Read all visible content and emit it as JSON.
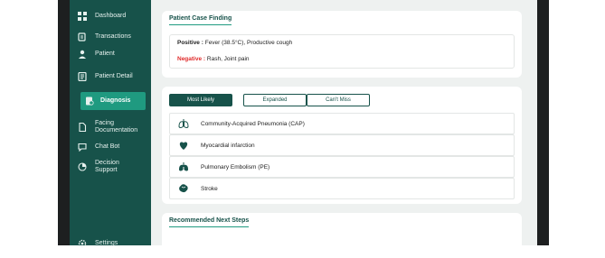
{
  "sidebar": {
    "items": [
      {
        "label": "Dashboard",
        "icon": "dashboard-icon"
      },
      {
        "label": "Transactions",
        "icon": "transactions-icon"
      },
      {
        "label": "Patient",
        "icon": "patient-icon"
      },
      {
        "label": "Patient Detail",
        "icon": "patient-detail-icon"
      },
      {
        "label": "Diagnosis",
        "icon": "diagnosis-icon",
        "active": true
      },
      {
        "label": "Facing Documentation",
        "icon": "documentation-icon"
      },
      {
        "label": "Chat Bot",
        "icon": "chat-icon"
      },
      {
        "label": "Decision Support",
        "icon": "decision-support-icon"
      },
      {
        "label": "Settings",
        "icon": "settings-icon"
      }
    ]
  },
  "case_finding": {
    "title": "Patient Case Finding",
    "positive_label": "Positive :",
    "positive_value": "Fever (38.5°C), Productive cough",
    "negative_label": "Negative :",
    "negative_value": "Rash, Joint pain"
  },
  "diagnosis": {
    "tabs": [
      "Most Likely",
      "Expanded",
      "Can't Miss"
    ],
    "active_tab": "Most Likely",
    "rows": [
      {
        "label": "Community-Acquired Pneumonia (CAP)",
        "icon": "lungs-icon"
      },
      {
        "label": "Myocardial infarction",
        "icon": "heart-icon"
      },
      {
        "label": "Pulmonary Embolism (PE)",
        "icon": "lungs-clot-icon"
      },
      {
        "label": "Stroke",
        "icon": "brain-icon"
      }
    ]
  },
  "next_steps": {
    "title": "Recommended Next Steps"
  },
  "colors": {
    "sidebar": "#17524a",
    "accent": "#1f9a80",
    "negative": "#e02a2a"
  }
}
